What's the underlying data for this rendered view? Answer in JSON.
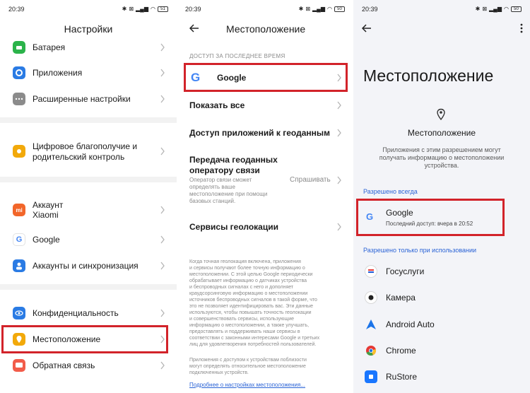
{
  "status": {
    "time": "20:39",
    "battery_1": "51",
    "battery_2": "50",
    "battery_3": "50"
  },
  "settings": {
    "title": "Настройки",
    "items": [
      {
        "label": "Батарея"
      },
      {
        "label": "Приложения"
      },
      {
        "label": "Расширенные настройки"
      },
      {
        "label": "Цифровое благополучие и родительский контроль",
        "line1": "Цифровое благополучие и",
        "line2": "родительский контроль"
      },
      {
        "label": "Аккаунт Xiaomi",
        "line1": "Аккаунт",
        "line2": "Xiaomi"
      },
      {
        "label": "Google"
      },
      {
        "label": "Аккаунты и синхронизация"
      },
      {
        "label": "Конфиденциальность"
      },
      {
        "label": "Местоположение"
      },
      {
        "label": "Обратная связь"
      }
    ],
    "colors": {
      "battery": "#2bb34a",
      "apps": "#2a7be4",
      "advanced": "#8b8b8b",
      "wellbeing": "#f2a90a",
      "xiaomi": "#f2662a",
      "accounts": "#2a7be4",
      "privacy": "#2a7be4",
      "location": "#f2a90a",
      "feedback": "#f25c4a"
    }
  },
  "location": {
    "title": "Местоположение",
    "recent_caption": "ДОСТУП ЗА ПОСЛЕДНЕЕ ВРЕМЯ",
    "recent_app": "Google",
    "show_all": "Показать все",
    "geo_access": "Доступ приложений к геоданным",
    "carrier_title_1": "Передача геоданных",
    "carrier_title_2": "оператору связи",
    "carrier_desc": [
      "Оператор связи сможет",
      "определять ваше",
      "местоположение при помощи",
      "базовых станций."
    ],
    "carrier_value": "Спрашивать",
    "geo_services": "Сервисы геолокации",
    "info_paragraph": [
      "Когда точная геолокация включена, приложения",
      "и сервисы получают более точную информацию о",
      "местоположении. С этой целью Google периодически",
      "обрабатывает информацию о датчиках устройства",
      "и беспроводных сигналах с него и дополняет",
      "краудсорсинговую информацию о местоположении",
      "источников беспроводных сигналов в такой форме, что",
      "это не позволяет идентифицировать вас. Эти данные",
      "используются, чтобы повышать точность геолокации",
      "и совершенствовать сервисы, использующие",
      "информацию о местоположении, а также улучшать,",
      "предоставлять и поддерживать наши сервисы в",
      "соответствии с законными интересами Google и третьих",
      "лиц для удовлетворения потребностей пользователей."
    ],
    "nearby_paragraph": [
      "Приложения с доступом к устройствам поблизости",
      "могут определять относительное местоположение",
      "подключенных устройств."
    ],
    "more_link": "Подробнее о настройках местоположения..."
  },
  "perm": {
    "title": "Местоположение",
    "sub_title": "Местоположение",
    "description": [
      "Приложения с этим разрешением могут",
      "получать информацию о местоположении",
      "устройства."
    ],
    "always_caption": "Разрешено всегда",
    "always_app": "Google",
    "always_detail": "Последний доступ: вчера в 20:52",
    "while_caption": "Разрешено только при использовании",
    "apps": [
      {
        "name": "Госуслуги",
        "icon": "gosuslugi-icon"
      },
      {
        "name": "Камера",
        "icon": "camera-icon"
      },
      {
        "name": "Android Auto",
        "icon": "android-auto-icon"
      },
      {
        "name": "Chrome",
        "icon": "chrome-icon"
      },
      {
        "name": "RuStore",
        "icon": "rustore-icon"
      }
    ]
  },
  "highlight_color": "#d2232a"
}
